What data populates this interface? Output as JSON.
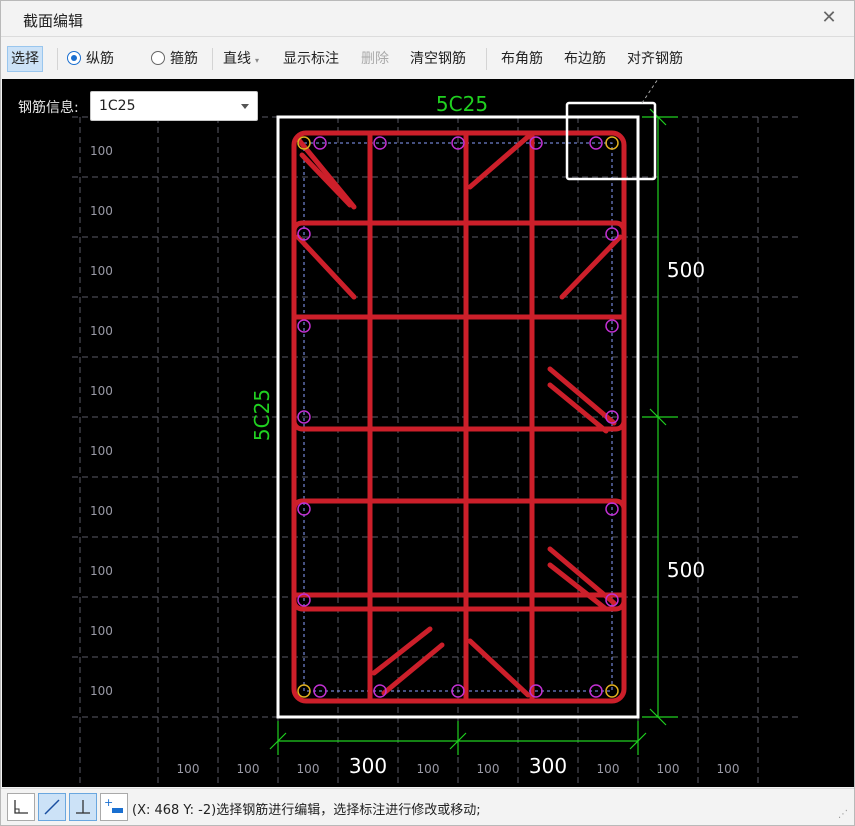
{
  "window": {
    "title": "截面编辑",
    "close_glyph": "✕"
  },
  "toolbar": {
    "select": "选择",
    "longitudinal": "纵筋",
    "stirrup": "箍筋",
    "line": "直线",
    "show_annotation": "显示标注",
    "delete": "删除",
    "clear_rebar": "清空钢筋",
    "corner_rebar": "布角筋",
    "edge_rebar": "布边筋",
    "align_rebar": "对齐钢筋"
  },
  "rebar_info": {
    "label": "钢筋信息:",
    "value": "1C25"
  },
  "drawing": {
    "top_label": "5C25",
    "left_label": "5C25",
    "dim_right_upper": "500",
    "dim_right_lower": "500",
    "dim_bottom_left": "300",
    "dim_bottom_right": "300",
    "grid_label": "100",
    "colors": {
      "rebar": "#cc1f2a",
      "dimension": "#20d020",
      "grid": "#5a5a66",
      "point": "#c030d0",
      "corner_point": "#e0b020",
      "outline": "#ffffff"
    }
  },
  "statusbar": {
    "text": "(X: 468 Y: -2)选择钢筋进行编辑，选择标注进行修改或移动;",
    "buttons": [
      "corner-snap-icon",
      "diagonal-line-icon",
      "perpendicular-icon",
      "add-dimension-icon"
    ]
  }
}
